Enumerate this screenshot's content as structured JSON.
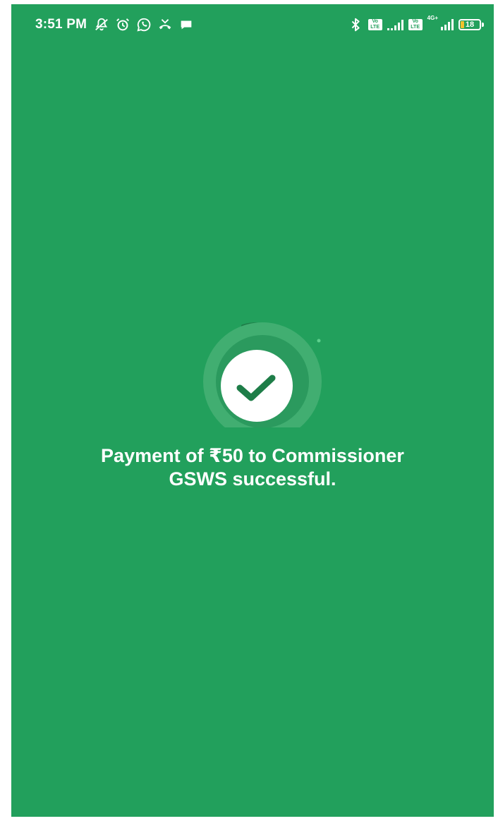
{
  "status_bar": {
    "time": "3:51 PM",
    "left_icons": [
      "mute-notifications-icon",
      "alarm-icon",
      "whatsapp-icon",
      "missed-call-icon",
      "chat-bubble-icon"
    ],
    "right_icons": [
      "bluetooth-icon",
      "volte-sim1-icon",
      "signal-sim1-icon",
      "volte-sim2-icon",
      "signal-sim2-icon",
      "battery-icon"
    ],
    "network_type": "4G+",
    "sim_badge_text": "Vo LTE",
    "battery_level": "18",
    "battery_fraction": 0.18
  },
  "success": {
    "line1": "Payment of ₹50 to Commissioner",
    "line2": "GSWS successful."
  },
  "colors": {
    "background": "#22a05c",
    "check": "#1e7d48",
    "badge": "#ffffff"
  }
}
